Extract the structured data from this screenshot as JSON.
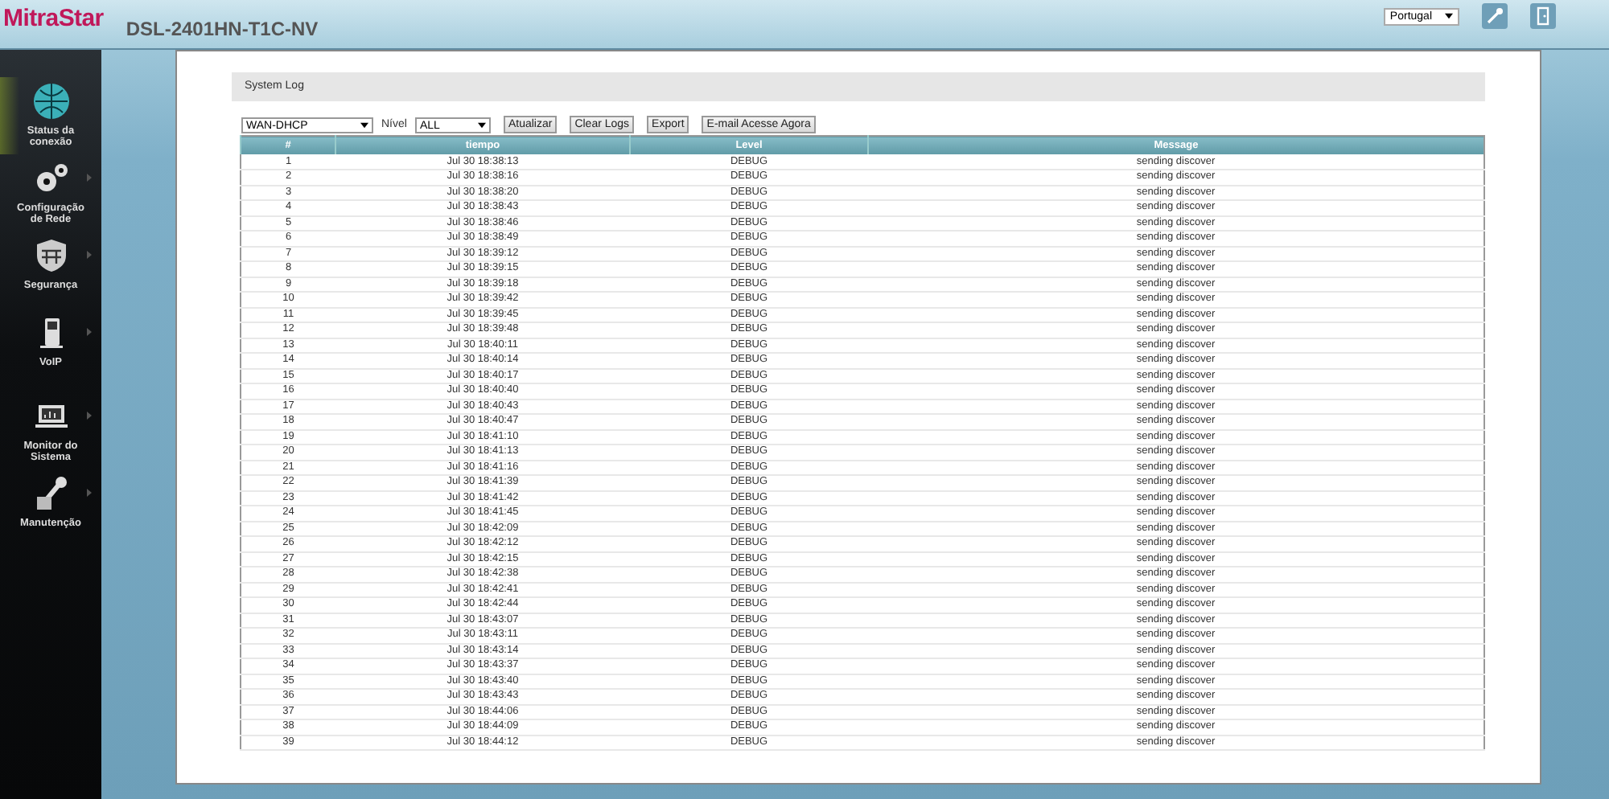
{
  "header": {
    "logo": "MitraStar",
    "model": "DSL-2401HN-T1C-NV",
    "language": "Portugal"
  },
  "sidebar": {
    "items": [
      {
        "label": "Status da conexão",
        "selected": true,
        "submenu": false
      },
      {
        "label": "Configuração de Rede",
        "selected": false,
        "submenu": true
      },
      {
        "label": "Segurança",
        "selected": false,
        "submenu": true
      },
      {
        "label": "VoIP",
        "selected": false,
        "submenu": true
      },
      {
        "label": "Monitor do Sistema",
        "selected": false,
        "submenu": true
      },
      {
        "label": "Manutenção",
        "selected": false,
        "submenu": true
      }
    ]
  },
  "panel_title": "System Log",
  "toolbar": {
    "interface": "WAN-DHCP",
    "level_label": "Nível",
    "level": "ALL",
    "buttons": [
      "Atualizar",
      "Clear Logs",
      "Export",
      "E-mail Acesse Agora"
    ]
  },
  "table": {
    "columns": [
      "#",
      "tiempo",
      "Level",
      "Message"
    ],
    "rows": [
      [
        "1",
        "Jul 30 18:38:13",
        "DEBUG",
        "sending discover"
      ],
      [
        "2",
        "Jul 30 18:38:16",
        "DEBUG",
        "sending discover"
      ],
      [
        "3",
        "Jul 30 18:38:20",
        "DEBUG",
        "sending discover"
      ],
      [
        "4",
        "Jul 30 18:38:43",
        "DEBUG",
        "sending discover"
      ],
      [
        "5",
        "Jul 30 18:38:46",
        "DEBUG",
        "sending discover"
      ],
      [
        "6",
        "Jul 30 18:38:49",
        "DEBUG",
        "sending discover"
      ],
      [
        "7",
        "Jul 30 18:39:12",
        "DEBUG",
        "sending discover"
      ],
      [
        "8",
        "Jul 30 18:39:15",
        "DEBUG",
        "sending discover"
      ],
      [
        "9",
        "Jul 30 18:39:18",
        "DEBUG",
        "sending discover"
      ],
      [
        "10",
        "Jul 30 18:39:42",
        "DEBUG",
        "sending discover"
      ],
      [
        "11",
        "Jul 30 18:39:45",
        "DEBUG",
        "sending discover"
      ],
      [
        "12",
        "Jul 30 18:39:48",
        "DEBUG",
        "sending discover"
      ],
      [
        "13",
        "Jul 30 18:40:11",
        "DEBUG",
        "sending discover"
      ],
      [
        "14",
        "Jul 30 18:40:14",
        "DEBUG",
        "sending discover"
      ],
      [
        "15",
        "Jul 30 18:40:17",
        "DEBUG",
        "sending discover"
      ],
      [
        "16",
        "Jul 30 18:40:40",
        "DEBUG",
        "sending discover"
      ],
      [
        "17",
        "Jul 30 18:40:43",
        "DEBUG",
        "sending discover"
      ],
      [
        "18",
        "Jul 30 18:40:47",
        "DEBUG",
        "sending discover"
      ],
      [
        "19",
        "Jul 30 18:41:10",
        "DEBUG",
        "sending discover"
      ],
      [
        "20",
        "Jul 30 18:41:13",
        "DEBUG",
        "sending discover"
      ],
      [
        "21",
        "Jul 30 18:41:16",
        "DEBUG",
        "sending discover"
      ],
      [
        "22",
        "Jul 30 18:41:39",
        "DEBUG",
        "sending discover"
      ],
      [
        "23",
        "Jul 30 18:41:42",
        "DEBUG",
        "sending discover"
      ],
      [
        "24",
        "Jul 30 18:41:45",
        "DEBUG",
        "sending discover"
      ],
      [
        "25",
        "Jul 30 18:42:09",
        "DEBUG",
        "sending discover"
      ],
      [
        "26",
        "Jul 30 18:42:12",
        "DEBUG",
        "sending discover"
      ],
      [
        "27",
        "Jul 30 18:42:15",
        "DEBUG",
        "sending discover"
      ],
      [
        "28",
        "Jul 30 18:42:38",
        "DEBUG",
        "sending discover"
      ],
      [
        "29",
        "Jul 30 18:42:41",
        "DEBUG",
        "sending discover"
      ],
      [
        "30",
        "Jul 30 18:42:44",
        "DEBUG",
        "sending discover"
      ],
      [
        "31",
        "Jul 30 18:43:07",
        "DEBUG",
        "sending discover"
      ],
      [
        "32",
        "Jul 30 18:43:11",
        "DEBUG",
        "sending discover"
      ],
      [
        "33",
        "Jul 30 18:43:14",
        "DEBUG",
        "sending discover"
      ],
      [
        "34",
        "Jul 30 18:43:37",
        "DEBUG",
        "sending discover"
      ],
      [
        "35",
        "Jul 30 18:43:40",
        "DEBUG",
        "sending discover"
      ],
      [
        "36",
        "Jul 30 18:43:43",
        "DEBUG",
        "sending discover"
      ],
      [
        "37",
        "Jul 30 18:44:06",
        "DEBUG",
        "sending discover"
      ],
      [
        "38",
        "Jul 30 18:44:09",
        "DEBUG",
        "sending discover"
      ],
      [
        "39",
        "Jul 30 18:44:12",
        "DEBUG",
        "sending discover"
      ]
    ]
  }
}
